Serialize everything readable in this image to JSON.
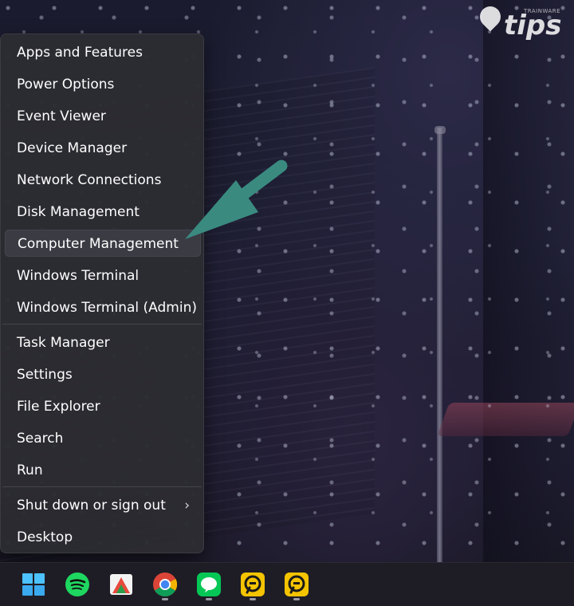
{
  "menu": {
    "items": [
      {
        "label": "Apps and Features"
      },
      {
        "label": "Power Options"
      },
      {
        "label": "Event Viewer"
      },
      {
        "label": "Device Manager"
      },
      {
        "label": "Network Connections"
      },
      {
        "label": "Disk Management"
      },
      {
        "label": "Computer Management",
        "active": true
      },
      {
        "label": "Windows Terminal"
      },
      {
        "label": "Windows Terminal (Admin)"
      },
      {
        "label": "Task Manager"
      },
      {
        "label": "Settings"
      },
      {
        "label": "File Explorer"
      },
      {
        "label": "Search"
      },
      {
        "label": "Run"
      },
      {
        "label": "Shut down or sign out",
        "submenu_indicator": "›"
      },
      {
        "label": "Desktop"
      }
    ]
  },
  "logo": {
    "word": "tips",
    "small_text": "TRAINWARE"
  },
  "taskbar": {
    "icons": [
      {
        "name": "windows-start-icon",
        "color": "#4cc2ff"
      },
      {
        "name": "spotify-icon",
        "color": "#1ed760"
      },
      {
        "name": "snipping-tool-icon",
        "color": "#e84a3c"
      },
      {
        "name": "chrome-icon",
        "color": "#4285f4"
      },
      {
        "name": "line-icon",
        "color": "#06c755"
      },
      {
        "name": "ld-player-icon",
        "color": "#f5c400"
      },
      {
        "name": "ld-player-icon",
        "color": "#f5c400"
      }
    ]
  },
  "annotation": {
    "arrow_color": "#3a8a80",
    "target": "Computer Management"
  }
}
